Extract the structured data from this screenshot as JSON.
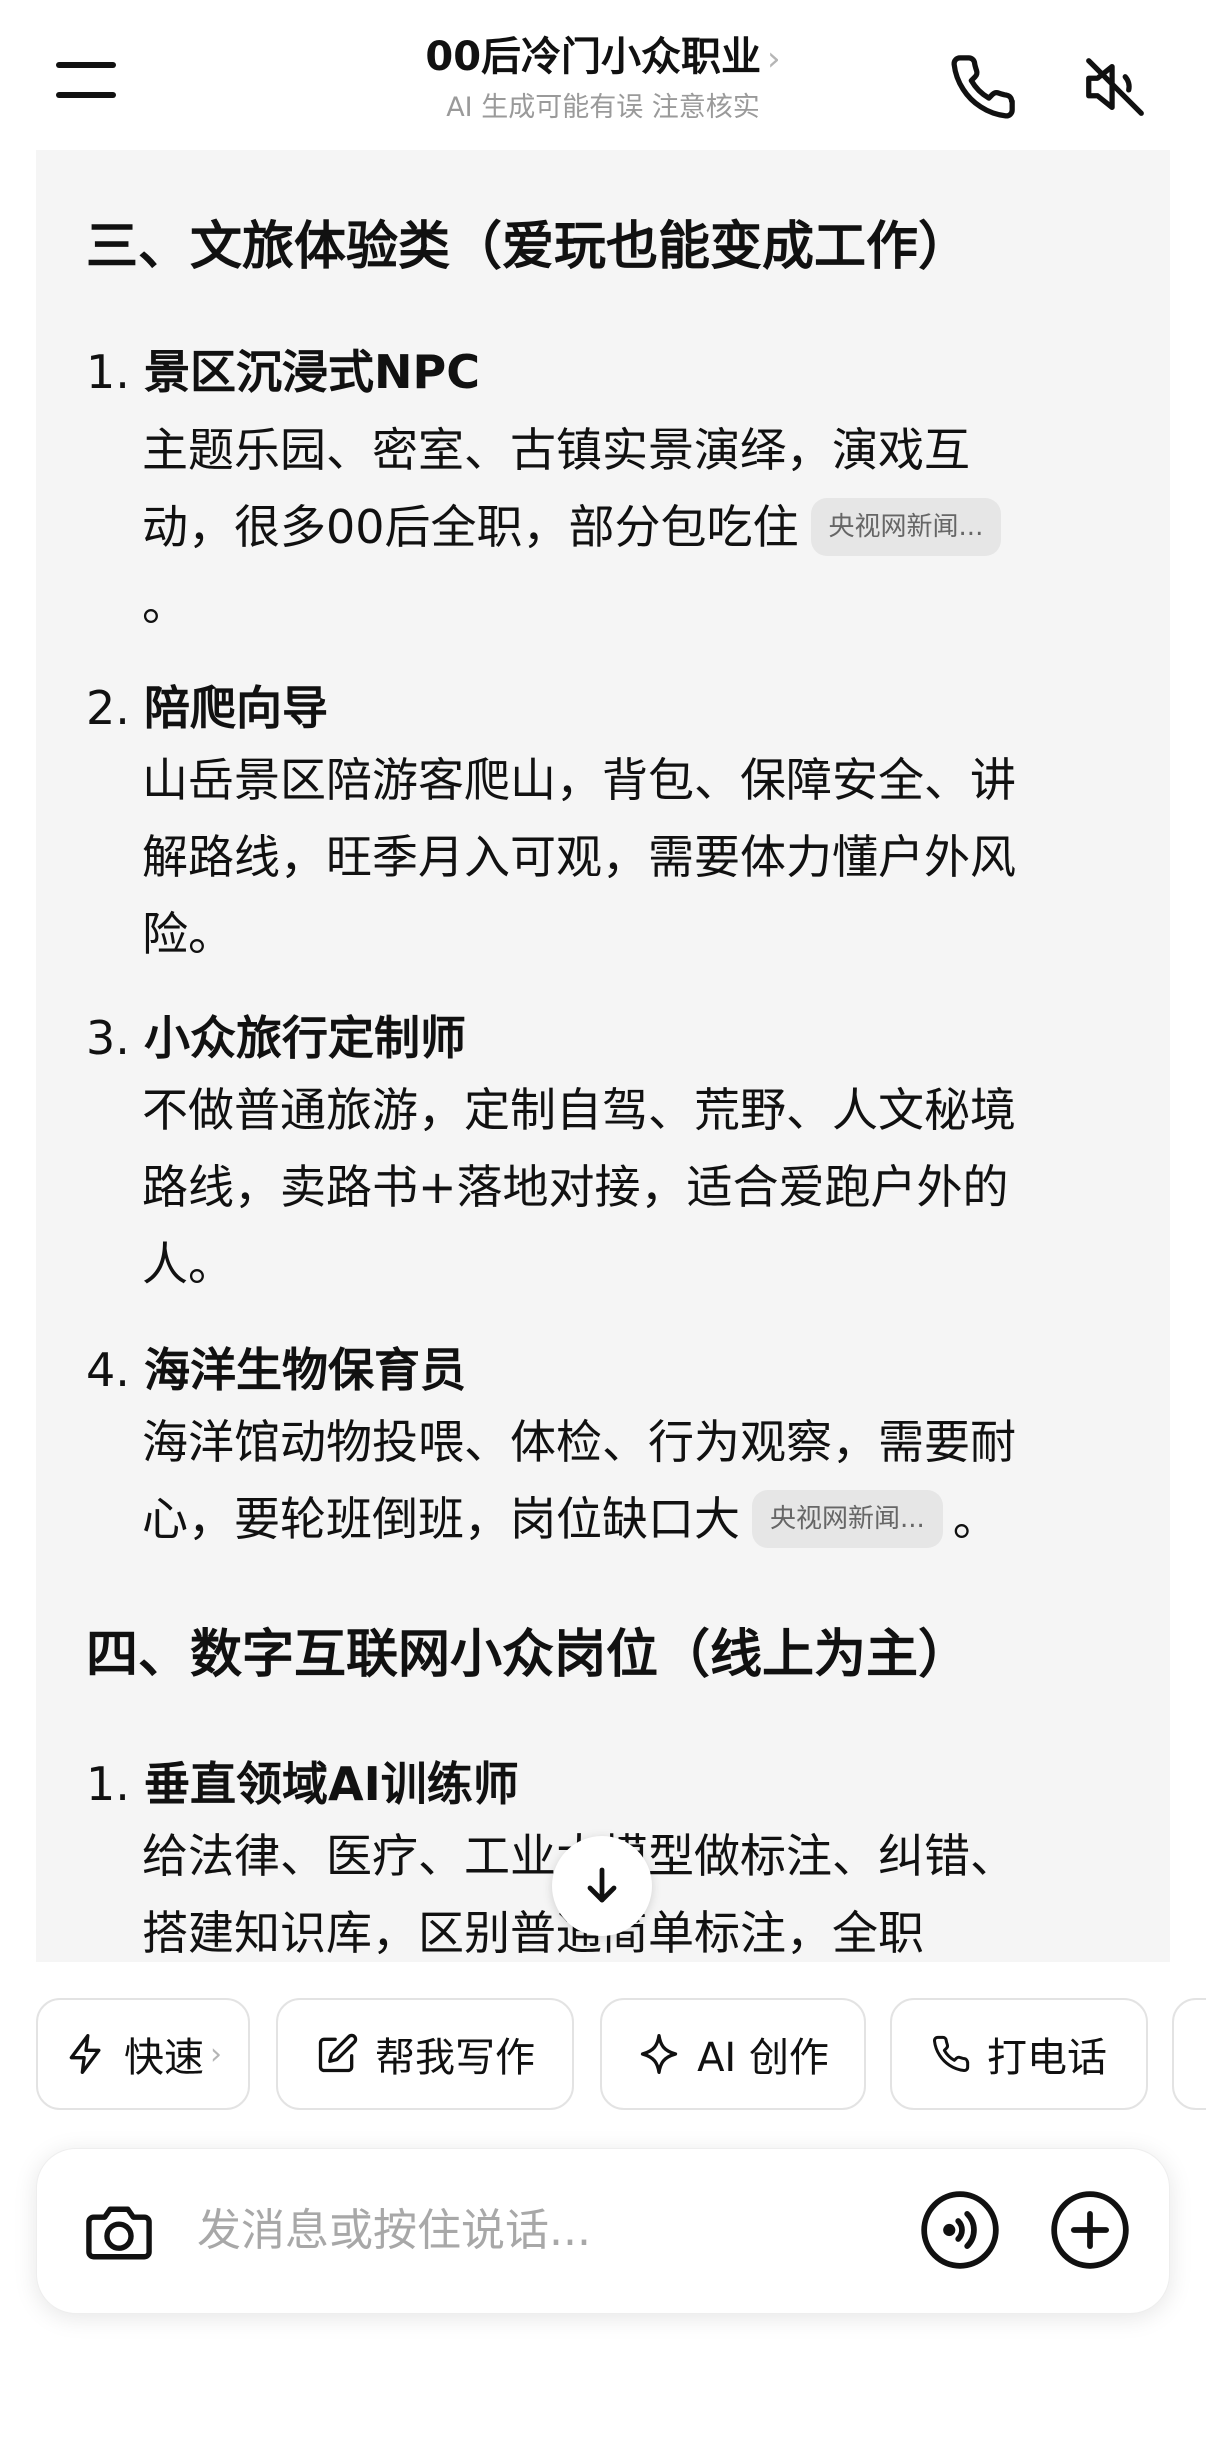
{
  "header": {
    "title": "00后冷门小众职业",
    "title_chevron": "›",
    "subtitle": "AI 生成可能有误 注意核实"
  },
  "sections": [
    {
      "title": "三、文旅体验类（爱玩也能变成工作）",
      "items": [
        {
          "num": "1.",
          "title": "景区沉浸式NPC",
          "lines": [
            "主题乐园、密室、古镇实景演绎，演戏互",
            "动，很多00后全职，部分包吃住",
            "。"
          ],
          "cite": "央视网新闻..."
        },
        {
          "num": "2.",
          "title": "陪爬向导",
          "lines": [
            "山岳景区陪游客爬山，背包、保障安全、讲",
            "解路线，旺季月入可观，需要体力懂户外风",
            "险。"
          ]
        },
        {
          "num": "3.",
          "title": "小众旅行定制师",
          "lines": [
            "不做普通旅游，定制自驾、荒野、人文秘境",
            "路线，卖路书+落地对接，适合爱跑户外的",
            "人。"
          ]
        },
        {
          "num": "4.",
          "title": "海洋生物保育员",
          "lines": [
            "海洋馆动物投喂、体检、行为观察，需要耐",
            "心，要轮班倒班，岗位缺口大"
          ],
          "cite": "央视网新闻...",
          "tail": "。"
        }
      ]
    },
    {
      "title": "四、数字互联网小众岗位（线上为主）",
      "items": [
        {
          "num": "1.",
          "title": "垂直领域AI训练师",
          "lines": [
            "给法律、医疗、工业大模型做标注、纠错、",
            "搭建知识库，区别普通简单标注，全职"
          ]
        }
      ]
    }
  ],
  "quick_actions": [
    {
      "label": "快速",
      "icon": "lightning-icon",
      "chevron": "›"
    },
    {
      "label": "帮我写作",
      "icon": "edit-icon"
    },
    {
      "label": "AI 创作",
      "icon": "sparkle-icon"
    },
    {
      "label": "打电话",
      "icon": "phone-icon"
    }
  ],
  "input": {
    "placeholder": "发消息或按住说话..."
  }
}
